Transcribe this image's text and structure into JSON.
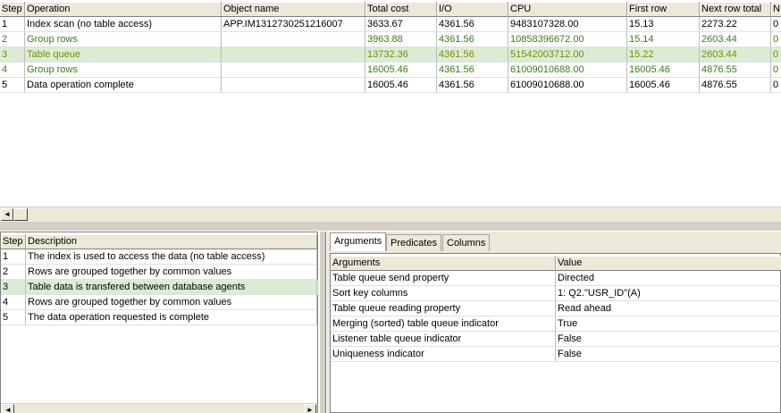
{
  "plan_grid": {
    "columns": [
      "Step",
      "Operation",
      "Object name",
      "Total cost",
      "I/O",
      "CPU",
      "First row",
      "Next row total",
      "N"
    ],
    "rows": [
      {
        "step": "1",
        "operation": "Index scan (no table access)",
        "object": "APP.IM1312730251216007",
        "total_cost": "3633.67",
        "io": "4361.56",
        "cpu": "9483107328.00",
        "first_row": "15.13",
        "next_row_total": "2273.22",
        "n": "0"
      },
      {
        "step": "2",
        "operation": "Group rows",
        "object": "",
        "total_cost": "3963.88",
        "io": "4361.56",
        "cpu": "10858396672.00",
        "first_row": "15.14",
        "next_row_total": "2603.44",
        "n": "0"
      },
      {
        "step": "3",
        "operation": "Table queue",
        "object": "",
        "total_cost": "13732.36",
        "io": "4361.56",
        "cpu": "51542003712.00",
        "first_row": "15.22",
        "next_row_total": "2603.44",
        "n": "0"
      },
      {
        "step": "4",
        "operation": "Group rows",
        "object": "",
        "total_cost": "16005.46",
        "io": "4361.56",
        "cpu": "61009010688.00",
        "first_row": "16005.46",
        "next_row_total": "4876.55",
        "n": "0"
      },
      {
        "step": "5",
        "operation": "Data operation complete",
        "object": "",
        "total_cost": "16005.46",
        "io": "4361.56",
        "cpu": "61009010688.00",
        "first_row": "16005.46",
        "next_row_total": "4876.55",
        "n": "0"
      }
    ]
  },
  "description_grid": {
    "columns": [
      "Step",
      "Description"
    ],
    "rows": [
      {
        "step": "1",
        "description": "The index is used to access the data (no table access)"
      },
      {
        "step": "2",
        "description": "Rows are grouped together by common values"
      },
      {
        "step": "3",
        "description": "Table data is transfered between database agents"
      },
      {
        "step": "4",
        "description": "Rows are grouped together by common values"
      },
      {
        "step": "5",
        "description": "The data operation requested is complete"
      }
    ]
  },
  "details": {
    "tabs": [
      "Arguments",
      "Predicates",
      "Columns"
    ],
    "columns": [
      "Arguments",
      "Value"
    ],
    "rows": [
      {
        "argument": "Table queue send property",
        "value": "Directed"
      },
      {
        "argument": "Sort key columns",
        "value": "1: Q2.\"USR_ID\"(A)"
      },
      {
        "argument": "Table queue reading property",
        "value": "Read ahead"
      },
      {
        "argument": "Merging (sorted) table queue indicator",
        "value": "True"
      },
      {
        "argument": "Listener table queue indicator",
        "value": "False"
      },
      {
        "argument": "Uniqueness indicator",
        "value": "False"
      }
    ]
  },
  "icons": {
    "scroll_left": "◄",
    "scroll_right": "►"
  },
  "colors": {
    "selected_row": "#dcecd4",
    "green_text": "#3a7a1c",
    "olive_text": "#7a8a00"
  }
}
